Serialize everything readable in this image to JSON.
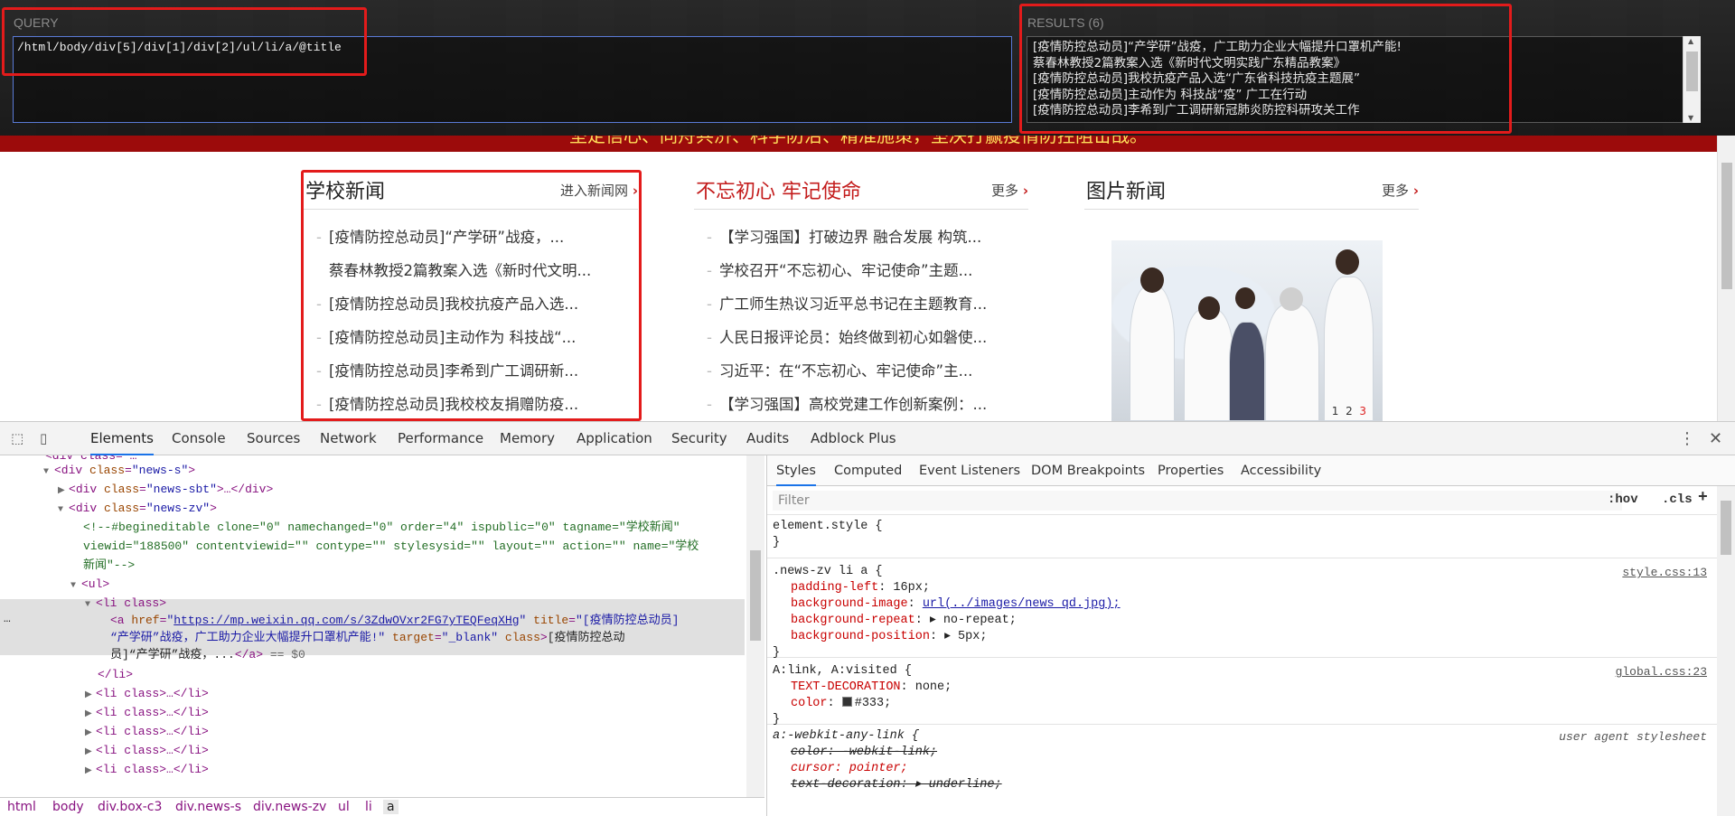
{
  "xpath_helper": {
    "query_label": "QUERY",
    "query_value": "/html/body/div[5]/div[1]/div[2]/ul/li/a/@title",
    "results_label": "RESULTS (6)",
    "results": [
      "[疫情防控总动员]“产学研”战疫，广工助力企业大幅提升口罩机产能!",
      "蔡春林教授2篇教案入选《新时代文明实践广东精品教案》",
      "[疫情防控总动员]我校抗疫产品入选“广东省科技抗疫主题展”",
      "[疫情防控总动员]主动作为 科技战“疫”  广工在行动",
      "[疫情防控总动员]李希到广工调研新冠肺炎防控科研攻关工作"
    ]
  },
  "page": {
    "marquee": "坚定信心、同舟共济、科学防治、精准施策，坚决打赢疫情防控阻击战。",
    "school_news": {
      "title": "学校新闻",
      "more": "进入新闻网",
      "items": [
        "[疫情防控总动员]“产学研”战疫，...",
        "蔡春林教授2篇教案入选《新时代文明...",
        "[疫情防控总动员]我校抗疫产品入选...",
        "[疫情防控总动员]主动作为 科技战“...",
        "[疫情防控总动员]李希到广工调研新...",
        "[疫情防控总动员]我校校友捐赠防疫..."
      ]
    },
    "mission_news": {
      "title": "不忘初心 牢记使命",
      "more": "更多",
      "title_color": "#c31b1b",
      "items": [
        "【学习强国】打破边界 融合发展 构筑...",
        "学校召开“不忘初心、牢记使命”主题...",
        "广工师生热议习近平总书记在主题教育...",
        "人民日报评论员：始终做到初心如磐使...",
        "习近平：在“不忘初心、牢记使命”主...",
        "【学习强国】高校党建工作创新案例：..."
      ]
    },
    "picture_news": {
      "title": "图片新闻",
      "more": "更多",
      "pager": [
        "1",
        "2",
        "3"
      ],
      "pager_active": "3"
    }
  },
  "devtools": {
    "tabs": [
      "Elements",
      "Console",
      "Sources",
      "Network",
      "Performance",
      "Memory",
      "Application",
      "Security",
      "Audits",
      "Adblock Plus"
    ],
    "active_tab": "Elements",
    "dom": {
      "l0": "div class=\"news-s\"",
      "l1_tag": "div",
      "l1_attr": "class",
      "l1_val": "\"news-sbt\"",
      "l1_tail": ">…</div>",
      "l2_tag": "div",
      "l2_attr": "class",
      "l2_val": "\"news-zv\"",
      "comment1": "<!--#begineditable clone=\"0\" namechanged=\"0\" order=\"4\" ispublic=\"0\" tagname=\"学校新闻\"",
      "comment2": "viewid=\"188500\" contentviewid=\"\" contype=\"\" stylesysid=\"\" layout=\"\" action=\"\" name=\"学校",
      "comment3": "新闻\"-->",
      "ul": "<ul>",
      "li_open": "<li class>",
      "a_href": "https://mp.weixin.qq.com/s/3ZdwOVxr2FG7yTEQFeqXHg",
      "a_title_1": "\"[疫情防控总动员]",
      "a_title_2": "“产学研”战疫，广工助力企业大幅提升口罩机产能!\"",
      "a_target": "\"_blank\"",
      "a_text_1": "[疫情防控总动",
      "a_text_2": "员]“产学研”战疫，...",
      "a_close": "</a>",
      "eq0": " == $0",
      "li_close": "</li>",
      "li_collapsed": "<li class>…</li>"
    },
    "breadcrumb": [
      "html",
      "body",
      "div.box-c3",
      "div.news-s",
      "div.news-zv",
      "ul",
      "li",
      "a"
    ],
    "styles_tabs": [
      "Styles",
      "Computed",
      "Event Listeners",
      "DOM Breakpoints",
      "Properties",
      "Accessibility"
    ],
    "filter_placeholder": "Filter",
    "hov": ":hov",
    "cls": ".cls",
    "rules": {
      "element_style": "element.style {",
      "r1_selector": ".news-zv li a {",
      "r1_src": "style.css:13",
      "r1_props": [
        {
          "name": "padding-left",
          "value": "16px;"
        },
        {
          "name": "background-image",
          "value": "url(../images/news_qd.jpg);"
        },
        {
          "name": "background-repeat",
          "value": "▸ no-repeat;"
        },
        {
          "name": "background-position",
          "value": "▸ 5px;"
        }
      ],
      "r2_selector": "A:link, A:visited {",
      "r2_src": "global.css:23",
      "r2_props": [
        {
          "name": "TEXT-DECORATION",
          "value": "none;"
        },
        {
          "name": "color",
          "value": "#333;"
        }
      ],
      "r3_selector": "a:-webkit-any-link {",
      "r3_src": "user agent stylesheet",
      "r3_props": [
        "color: -webkit-link;",
        "cursor: pointer;",
        "text-decoration: ▸ underline;"
      ],
      "close": "}"
    }
  }
}
